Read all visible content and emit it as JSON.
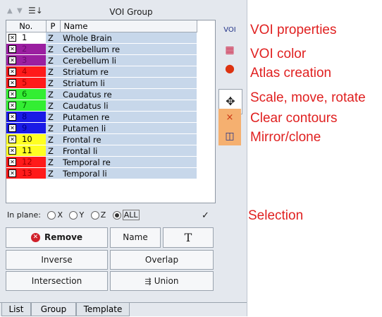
{
  "header": {
    "title": "VOI Group"
  },
  "table": {
    "columns": [
      "No.",
      "P",
      "Name"
    ],
    "rows": [
      {
        "no": "1",
        "p": "Z",
        "name": "Whole Brain",
        "color": "#ffffff",
        "text": "#000000"
      },
      {
        "no": "2",
        "p": "Z",
        "name": "Cerebellum re",
        "color": "#9b1fa0",
        "text": "#6a0d70"
      },
      {
        "no": "3",
        "p": "Z",
        "name": "Cerebellum li",
        "color": "#9b1fa0",
        "text": "#6a0d70"
      },
      {
        "no": "4",
        "p": "Z",
        "name": "Striatum re",
        "color": "#ff1a1a",
        "text": "#a00000"
      },
      {
        "no": "5",
        "p": "Z",
        "name": "Striatum li",
        "color": "#ff1a1a",
        "text": "#a00000"
      },
      {
        "no": "6",
        "p": "Z",
        "name": "Caudatus re",
        "color": "#33ee33",
        "text": "#006600"
      },
      {
        "no": "7",
        "p": "Z",
        "name": "Caudatus li",
        "color": "#33ee33",
        "text": "#006600"
      },
      {
        "no": "8",
        "p": "Z",
        "name": "Putamen re",
        "color": "#1a1ae6",
        "text": "#00008a"
      },
      {
        "no": "9",
        "p": "Z",
        "name": "Putamen li",
        "color": "#1a1ae6",
        "text": "#00008a"
      },
      {
        "no": "10",
        "p": "Z",
        "name": "Frontal re",
        "color": "#ffff22",
        "text": "#000000"
      },
      {
        "no": "11",
        "p": "Z",
        "name": "Frontal li",
        "color": "#ffff22",
        "text": "#000000"
      },
      {
        "no": "12",
        "p": "Z",
        "name": "Temporal re",
        "color": "#ff1a1a",
        "text": "#a00000"
      },
      {
        "no": "13",
        "p": "Z",
        "name": "Temporal li",
        "color": "#ff1a1a",
        "text": "#a00000"
      }
    ]
  },
  "sidebar_icons": [
    {
      "name": "voi-properties-icon",
      "glyph": "VOI"
    },
    {
      "name": "voi-color-icon",
      "glyph": "▦"
    },
    {
      "name": "atlas-creation-icon",
      "glyph": "●"
    },
    {
      "name": "scale-move-rotate-icon",
      "glyph": "✥"
    },
    {
      "name": "clear-contours-icon",
      "glyph": "×"
    },
    {
      "name": "mirror-clone-icon",
      "glyph": "◫"
    }
  ],
  "inplane": {
    "label": "In plane:",
    "options": [
      "X",
      "Y",
      "Z",
      "ALL"
    ],
    "selected": "ALL",
    "check": "✓"
  },
  "buttons": {
    "remove": "Remove",
    "name": "Name",
    "text": "T",
    "inverse": "Inverse",
    "overlap": "Overlap",
    "intersection": "Intersection",
    "union": "Union"
  },
  "tabs": [
    "List",
    "Group",
    "Template"
  ],
  "callouts": {
    "voi_properties": "VOI properties",
    "voi_color": "VOI color",
    "atlas_creation": "Atlas creation",
    "scale_move_rotate": "Scale, move, rotate",
    "clear_contours": "Clear contours",
    "mirror_clone": "Mirror/clone",
    "selection": "Selection"
  },
  "colors": {
    "callout": "#e02020",
    "selection": "#c7d7ea",
    "highlight": "#f5b070"
  }
}
